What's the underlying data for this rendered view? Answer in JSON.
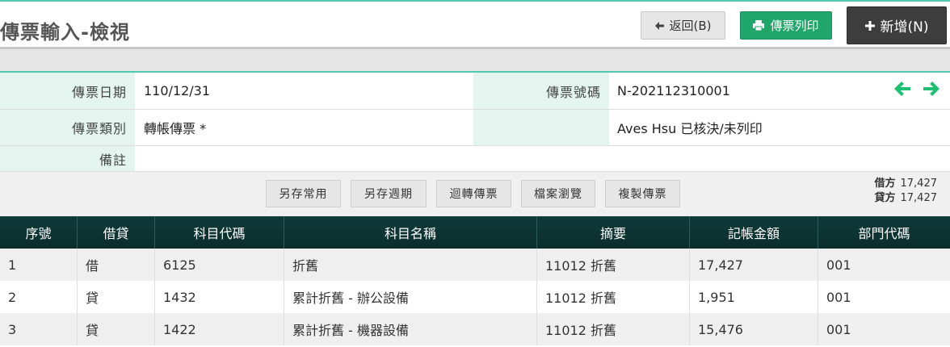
{
  "header": {
    "title": "傳票輸入-檢視",
    "back_label": "返回(B)",
    "print_label": "傳票列印",
    "add_label": "新增(N)"
  },
  "form": {
    "date_label": "傳票日期",
    "date_value": "110/12/31",
    "number_label": "傳票號碼",
    "number_value": "N-202112310001",
    "type_label": "傳票類別",
    "type_value": "轉帳傳票 *",
    "status_value": "Aves Hsu 已核決/未列印",
    "remark_label": "備註",
    "remark_value": ""
  },
  "toolbar": {
    "buttons": [
      "另存常用",
      "另存週期",
      "迴轉傳票",
      "檔案瀏覽",
      "複製傳票"
    ],
    "debit_label": "借方",
    "debit_total": "17,427",
    "credit_label": "貸方",
    "credit_total": "17,427"
  },
  "table": {
    "headers": [
      "序號",
      "借貸",
      "科目代碼",
      "科目名稱",
      "摘要",
      "記帳金額",
      "部門代碼"
    ],
    "rows": [
      [
        "1",
        "借",
        "6125",
        "折舊",
        "11012 折舊",
        "17,427",
        "001"
      ],
      [
        "2",
        "貸",
        "1432",
        "累計折舊 - 辦公設備",
        "11012 折舊",
        "1,951",
        "001"
      ],
      [
        "3",
        "貸",
        "1422",
        "累計折舊 - 機器設備",
        "11012 折舊",
        "15,476",
        "001"
      ]
    ]
  },
  "icons": {
    "back": "arrow-left-icon",
    "print": "printer-icon",
    "add": "plus-icon",
    "prev": "arrow-left-icon",
    "next": "arrow-right-icon"
  },
  "colors": {
    "accent": "#4fc9b0",
    "print_button": "#20a56a",
    "add_button": "#3d3d3d",
    "nav_arrow": "#1fbf72",
    "table_header": "#0f3b3a"
  }
}
